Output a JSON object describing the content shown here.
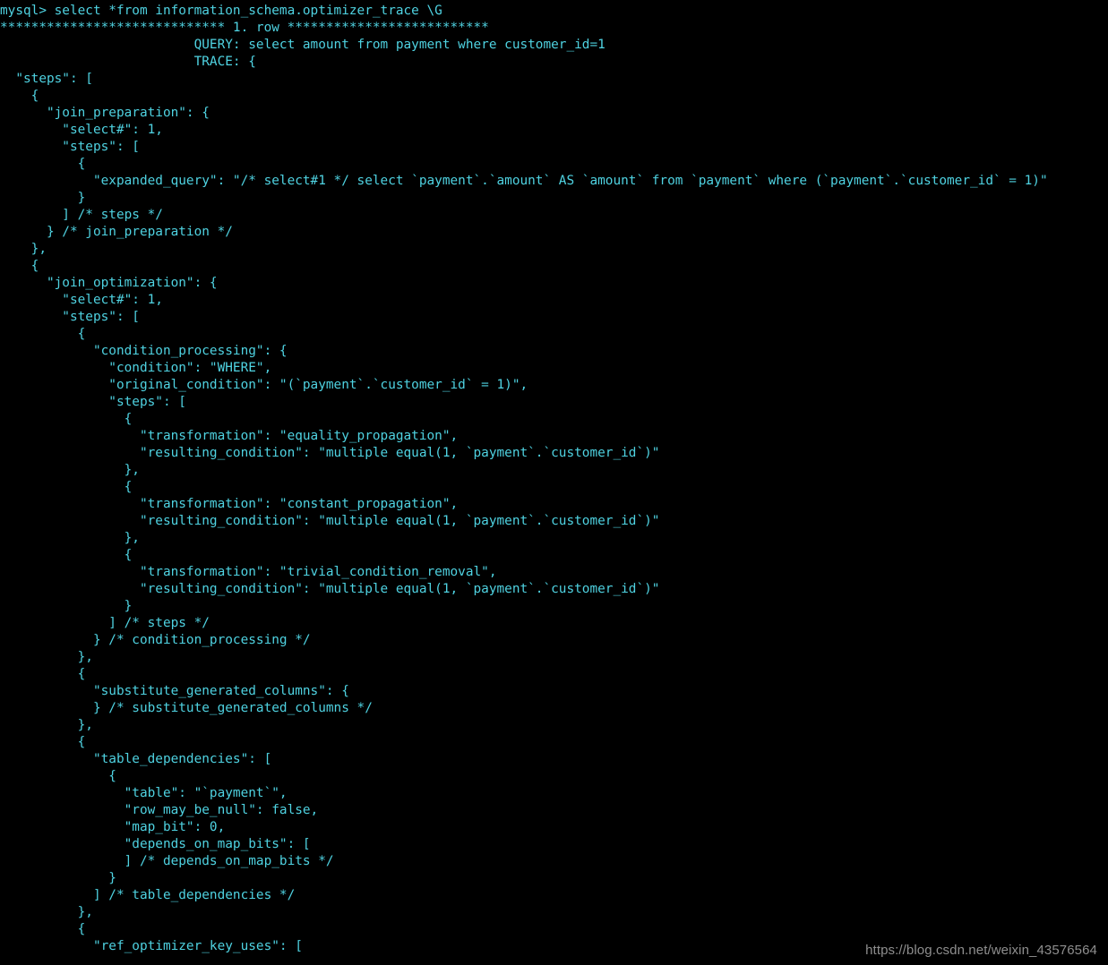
{
  "terminal": {
    "background_color": "#000000",
    "text_color": "#4fd3e2",
    "prompt": "mysql>",
    "command": "select *from information_schema.optimizer_trace \\G",
    "prompt_line": "mysql> select *from information_schema.optimizer_trace \\G",
    "row_separator": "***************************** 1. row **************************",
    "row_label": "1. row",
    "query_field_label": "QUERY:",
    "query_field_value": "select amount from payment where customer_id=1",
    "trace_field_label": "TRACE:",
    "trace_field_value": "{",
    "lines": [
      "mysql> select *from information_schema.optimizer_trace \\G",
      "***************************** 1. row **************************",
      "                         QUERY: select amount from payment where customer_id=1",
      "                         TRACE: {",
      "  \"steps\": [",
      "    {",
      "      \"join_preparation\": {",
      "        \"select#\": 1,",
      "        \"steps\": [",
      "          {",
      "            \"expanded_query\": \"/* select#1 */ select `payment`.`amount` AS `amount` from `payment` where (`payment`.`customer_id` = 1)\"",
      "          }",
      "        ] /* steps */",
      "      } /* join_preparation */",
      "    },",
      "    {",
      "      \"join_optimization\": {",
      "        \"select#\": 1,",
      "        \"steps\": [",
      "          {",
      "            \"condition_processing\": {",
      "              \"condition\": \"WHERE\",",
      "              \"original_condition\": \"(`payment`.`customer_id` = 1)\",",
      "              \"steps\": [",
      "                {",
      "                  \"transformation\": \"equality_propagation\",",
      "                  \"resulting_condition\": \"multiple equal(1, `payment`.`customer_id`)\"",
      "                },",
      "                {",
      "                  \"transformation\": \"constant_propagation\",",
      "                  \"resulting_condition\": \"multiple equal(1, `payment`.`customer_id`)\"",
      "                },",
      "                {",
      "                  \"transformation\": \"trivial_condition_removal\",",
      "                  \"resulting_condition\": \"multiple equal(1, `payment`.`customer_id`)\"",
      "                }",
      "              ] /* steps */",
      "            } /* condition_processing */",
      "          },",
      "          {",
      "            \"substitute_generated_columns\": {",
      "            } /* substitute_generated_columns */",
      "          },",
      "          {",
      "            \"table_dependencies\": [",
      "              {",
      "                \"table\": \"`payment`\",",
      "                \"row_may_be_null\": false,",
      "                \"map_bit\": 0,",
      "                \"depends_on_map_bits\": [",
      "                ] /* depends_on_map_bits */",
      "              }",
      "            ] /* table_dependencies */",
      "          },",
      "          {",
      "            \"ref_optimizer_key_uses\": ["
    ],
    "trace_values": {
      "select_number": 1,
      "expanded_query": "/* select#1 */ select `payment`.`amount` AS `amount` from `payment` where (`payment`.`customer_id` = 1)",
      "condition": "WHERE",
      "original_condition": "(`payment`.`customer_id` = 1)",
      "transformations": [
        "equality_propagation",
        "constant_propagation",
        "trivial_condition_removal"
      ],
      "resulting_condition": "multiple equal(1, `payment`.`customer_id`)",
      "table": "`payment`",
      "row_may_be_null": "false",
      "map_bit": "0"
    }
  },
  "watermark": {
    "text": "https://blog.csdn.net/weixin_43576564",
    "color": "#8e8e8e"
  }
}
